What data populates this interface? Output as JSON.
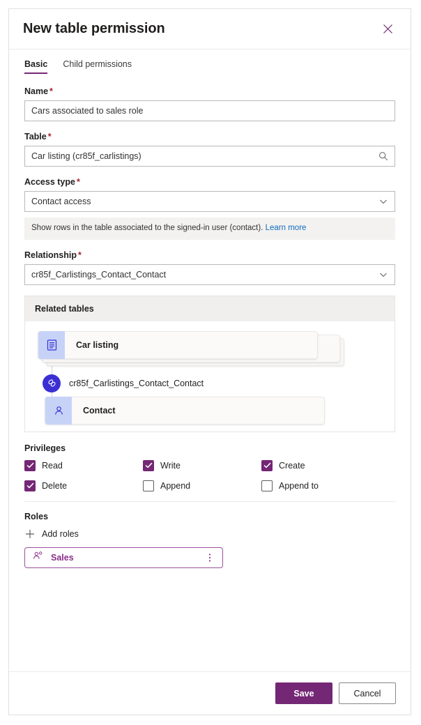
{
  "dialog": {
    "title": "New table permission",
    "close_icon": "close-icon"
  },
  "tabs": [
    {
      "label": "Basic",
      "active": true
    },
    {
      "label": "Child permissions",
      "active": false
    }
  ],
  "fields": {
    "name": {
      "label": "Name",
      "required_mark": "*",
      "value": "Cars associated to sales role",
      "placeholder": ""
    },
    "table": {
      "label": "Table",
      "required_mark": "*",
      "value": "Car listing (cr85f_carlistings)",
      "placeholder": "",
      "affix_icon": "search-icon"
    },
    "access_type": {
      "label": "Access type",
      "required_mark": "*",
      "value": "Contact access",
      "affix_icon": "chevron-down-icon",
      "info_text": "Show rows in the table associated to the signed-in user (contact).",
      "info_link": "Learn more"
    },
    "relationship": {
      "label": "Relationship",
      "required_mark": "*",
      "value": "cr85f_Carlistings_Contact_Contact",
      "affix_icon": "chevron-down-icon"
    }
  },
  "related_tables": {
    "header": "Related tables",
    "source_node": {
      "label": "Car listing",
      "icon": "table-icon",
      "stacked": true
    },
    "relationship_node": {
      "label": "cr85f_Carlistings_Contact_Contact",
      "icon": "link-icon"
    },
    "target_node": {
      "label": "Contact",
      "icon": "person-icon",
      "stacked": false
    }
  },
  "privileges": {
    "label": "Privileges",
    "items": [
      {
        "label": "Read",
        "checked": true
      },
      {
        "label": "Write",
        "checked": true
      },
      {
        "label": "Create",
        "checked": true
      },
      {
        "label": "Delete",
        "checked": true
      },
      {
        "label": "Append",
        "checked": false
      },
      {
        "label": "Append to",
        "checked": false
      }
    ]
  },
  "roles": {
    "label": "Roles",
    "add_label": "Add roles",
    "add_icon": "plus-icon",
    "items": [
      {
        "name": "Sales",
        "icon": "people-icon",
        "more_icon": "more-vertical-icon"
      }
    ]
  },
  "footer": {
    "save_label": "Save",
    "cancel_label": "Cancel"
  },
  "colors": {
    "accent_purple": "#742774",
    "role_purple": "#8a2f8a",
    "link_blue": "#0f6cbd",
    "required_red": "#a4262c",
    "node_indigo": "#3b2fd4",
    "node_tile": "#c7d2f7",
    "info_bg": "#f3f2f1"
  }
}
